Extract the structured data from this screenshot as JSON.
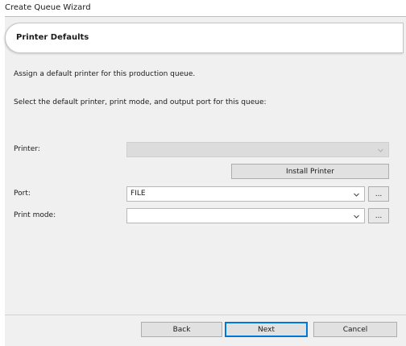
{
  "window": {
    "title": "Create Queue Wizard"
  },
  "header": {
    "title": "Printer Defaults"
  },
  "description": {
    "line1": "Assign a default printer for this production queue.",
    "line2": "Select the default printer, print mode, and output port for this queue:"
  },
  "printer": {
    "label": "Printer:",
    "value": ""
  },
  "install_printer": {
    "label": "Install Printer"
  },
  "port": {
    "label": "Port:",
    "value": "FILE",
    "browse_label": "..."
  },
  "print_mode": {
    "label": "Print mode:",
    "value": "",
    "browse_label": "..."
  },
  "footer": {
    "back_label": "Back",
    "next_label": "Next",
    "cancel_label": "Cancel"
  },
  "icons": {
    "dropdown": "chevron-down-icon"
  },
  "colors": {
    "panel": "#f0f0f0",
    "accent": "#0078d7",
    "disabled": "#dcdcdc"
  }
}
